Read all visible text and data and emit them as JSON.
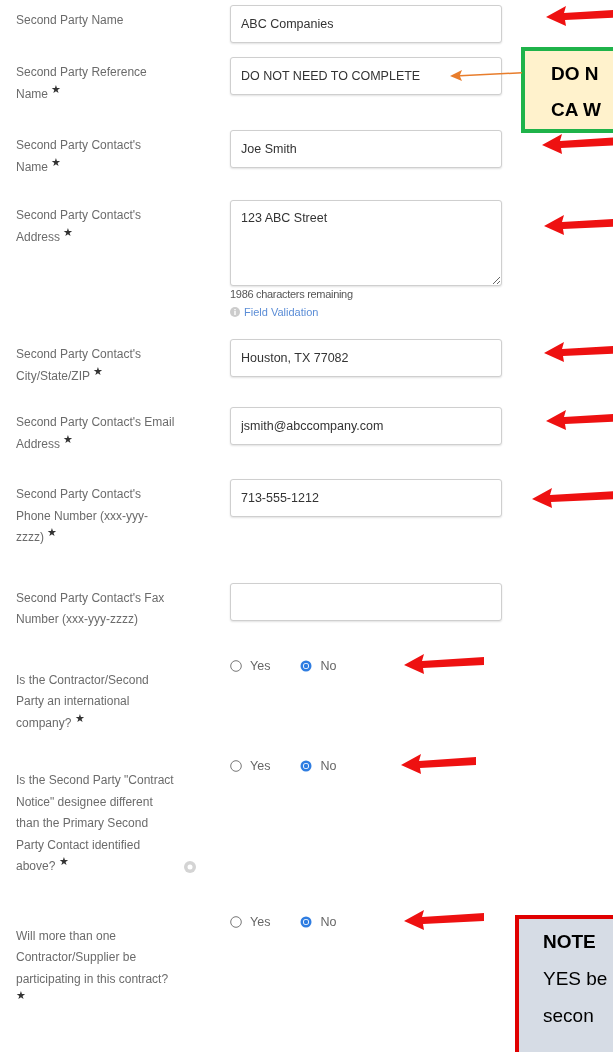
{
  "fields": [
    {
      "kind": "text",
      "label": "Second Party Name",
      "value": "ABC Companies",
      "arrow": true
    },
    {
      "kind": "text",
      "label": "Second Party Reference Name $^{★}$",
      "value": "DO NOT NEED TO COMPLETE",
      "arrow": false
    },
    {
      "kind": "text",
      "label": "Second Party Contact's Name $^{★}$",
      "value": "Joe Smith",
      "arrow": true
    },
    {
      "kind": "textarea",
      "label": "Second Party Contact's Address $^{★}$",
      "value": "123 ABC Street",
      "arrow": true,
      "counter": "1986 characters remaining",
      "link": "Field Validation"
    },
    {
      "kind": "text",
      "label": "Second Party Contact's City/State/ZIP $^{★}$",
      "value": "Houston, TX 77082",
      "arrow": true
    },
    {
      "kind": "text",
      "label": "Second Party Contact's Email Address $^{★}$",
      "value": "jsmith@abccompany.com",
      "arrow": true
    },
    {
      "kind": "text",
      "label": "Second Party Contact's Phone Number (xxx-yyy-zzzz) $^{★}$",
      "value": "713-555-1212",
      "arrow": true
    },
    {
      "kind": "text",
      "label": "Second Party Contact's Fax Number (xxx-yyy-zzzz)",
      "arrow": false
    },
    {
      "kind": "radio",
      "label": "Is the Contractor/Second Party an international company? $^{★}$",
      "options": [
        {
          "label": "Yes",
          "selected": false
        },
        {
          "label": "No",
          "selected": true
        }
      ],
      "arrow": true
    },
    {
      "kind": "radio",
      "label": "Is the Second Party \"Contract Notice\" designee different than the Primary Second Party Contact identified above? $^{★}$",
      "help": true,
      "options": [
        {
          "label": "Yes",
          "selected": false
        },
        {
          "label": "No",
          "selected": true
        }
      ],
      "arrow": true
    },
    {
      "kind": "radio",
      "label": "Will more than one Contractor/Supplier be participating in this contract? $^{★}$",
      "options": [
        {
          "label": "Yes",
          "selected": false
        },
        {
          "label": "No",
          "selected": true
        }
      ],
      "arrow": true
    }
  ],
  "callouts": [
    {
      "kind": "green",
      "lines": [
        "DO N",
        "CA W"
      ],
      "arrow": true
    },
    {
      "kind": "red",
      "lines": [
        "NOTE",
        "YES be",
        "secon"
      ],
      "arrow": false
    }
  ]
}
